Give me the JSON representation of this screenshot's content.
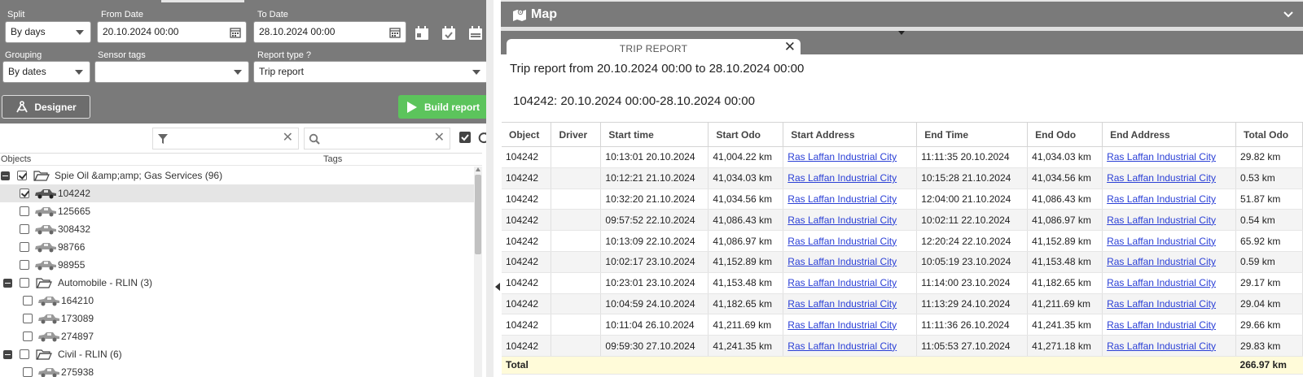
{
  "filters": {
    "split_label": "Split",
    "split_value": "By days",
    "from_label": "From Date",
    "from_value": "20.10.2024 00:00",
    "to_label": "To Date",
    "to_value": "28.10.2024 00:00",
    "grouping_label": "Grouping",
    "grouping_value": "By dates",
    "sensor_tags_label": "Sensor tags",
    "sensor_tags_value": "",
    "report_type_label": "Report type ?",
    "report_type_value": "Trip report",
    "designer_label": "Designer",
    "build_label": "Build report"
  },
  "tree_columns": {
    "objects": "Objects",
    "tags": "Tags"
  },
  "tree": [
    {
      "type": "group",
      "label": "Spie Oil &amp;amp; Gas Services (96)",
      "checked": true
    },
    {
      "type": "item",
      "label": "104242",
      "checked": true,
      "selected": true
    },
    {
      "type": "item",
      "label": "125665",
      "checked": false
    },
    {
      "type": "item",
      "label": "308432",
      "checked": false
    },
    {
      "type": "item",
      "label": "98766",
      "checked": false
    },
    {
      "type": "item",
      "label": "98955",
      "checked": false
    },
    {
      "type": "group",
      "label": "Automobile - RLIN (3)",
      "checked": false
    },
    {
      "type": "item",
      "label": "164210",
      "checked": false
    },
    {
      "type": "item",
      "label": "173089",
      "checked": false
    },
    {
      "type": "item",
      "label": "274897",
      "checked": false
    },
    {
      "type": "group",
      "label": "Civil - RLIN (6)",
      "checked": false
    },
    {
      "type": "item",
      "label": "275938",
      "checked": false
    }
  ],
  "map": {
    "title": "Map"
  },
  "report": {
    "tab_label": "TRIP REPORT",
    "title": "Trip report from 20.10.2024 00:00 to 28.10.2024 00:00",
    "subtitle": "104242: 20.10.2024 00:00-28.10.2024 00:00",
    "columns": [
      "Object",
      "Driver",
      "Start time",
      "Start Odo",
      "Start Address",
      "End Time",
      "End Odo",
      "End Address",
      "Total Odo"
    ],
    "rows": [
      [
        "104242",
        "",
        "10:13:01 20.10.2024",
        "41,004.22 km",
        "Ras Laffan Industrial City",
        "11:11:35 20.10.2024",
        "41,034.03 km",
        "Ras Laffan Industrial City",
        "29.82 km"
      ],
      [
        "104242",
        "",
        "10:12:21 21.10.2024",
        "41,034.03 km",
        "Ras Laffan Industrial City",
        "10:15:28 21.10.2024",
        "41,034.56 km",
        "Ras Laffan Industrial City",
        "0.53 km"
      ],
      [
        "104242",
        "",
        "10:32:20 21.10.2024",
        "41,034.56 km",
        "Ras Laffan Industrial City",
        "12:04:00 21.10.2024",
        "41,086.43 km",
        "Ras Laffan Industrial City",
        "51.87 km"
      ],
      [
        "104242",
        "",
        "09:57:52 22.10.2024",
        "41,086.43 km",
        "Ras Laffan Industrial City",
        "10:02:11 22.10.2024",
        "41,086.97 km",
        "Ras Laffan Industrial City",
        "0.54 km"
      ],
      [
        "104242",
        "",
        "10:13:09 22.10.2024",
        "41,086.97 km",
        "Ras Laffan Industrial City",
        "12:20:24 22.10.2024",
        "41,152.89 km",
        "Ras Laffan Industrial City",
        "65.92 km"
      ],
      [
        "104242",
        "",
        "10:02:17 23.10.2024",
        "41,152.89 km",
        "Ras Laffan Industrial City",
        "10:05:19 23.10.2024",
        "41,153.48 km",
        "Ras Laffan Industrial City",
        "0.59 km"
      ],
      [
        "104242",
        "",
        "10:23:01 23.10.2024",
        "41,153.48 km",
        "Ras Laffan Industrial City",
        "11:14:00 23.10.2024",
        "41,182.65 km",
        "Ras Laffan Industrial City",
        "29.17 km"
      ],
      [
        "104242",
        "",
        "10:04:59 24.10.2024",
        "41,182.65 km",
        "Ras Laffan Industrial City",
        "11:13:29 24.10.2024",
        "41,211.69 km",
        "Ras Laffan Industrial City",
        "29.04 km"
      ],
      [
        "104242",
        "",
        "10:11:04 26.10.2024",
        "41,211.69 km",
        "Ras Laffan Industrial City",
        "11:11:36 26.10.2024",
        "41,241.35 km",
        "Ras Laffan Industrial City",
        "29.66 km"
      ],
      [
        "104242",
        "",
        "09:59:30 27.10.2024",
        "41,241.35 km",
        "Ras Laffan Industrial City",
        "11:05:53 27.10.2024",
        "41,271.18 km",
        "Ras Laffan Industrial City",
        "29.83 km"
      ]
    ],
    "total_label": "Total",
    "total_value": "266.97 km"
  },
  "colors": {
    "panel_gray": "#7a7a7a",
    "build_green": "#5cc45c",
    "link_blue": "#2a3fd6",
    "total_bg": "#fffbd9"
  }
}
